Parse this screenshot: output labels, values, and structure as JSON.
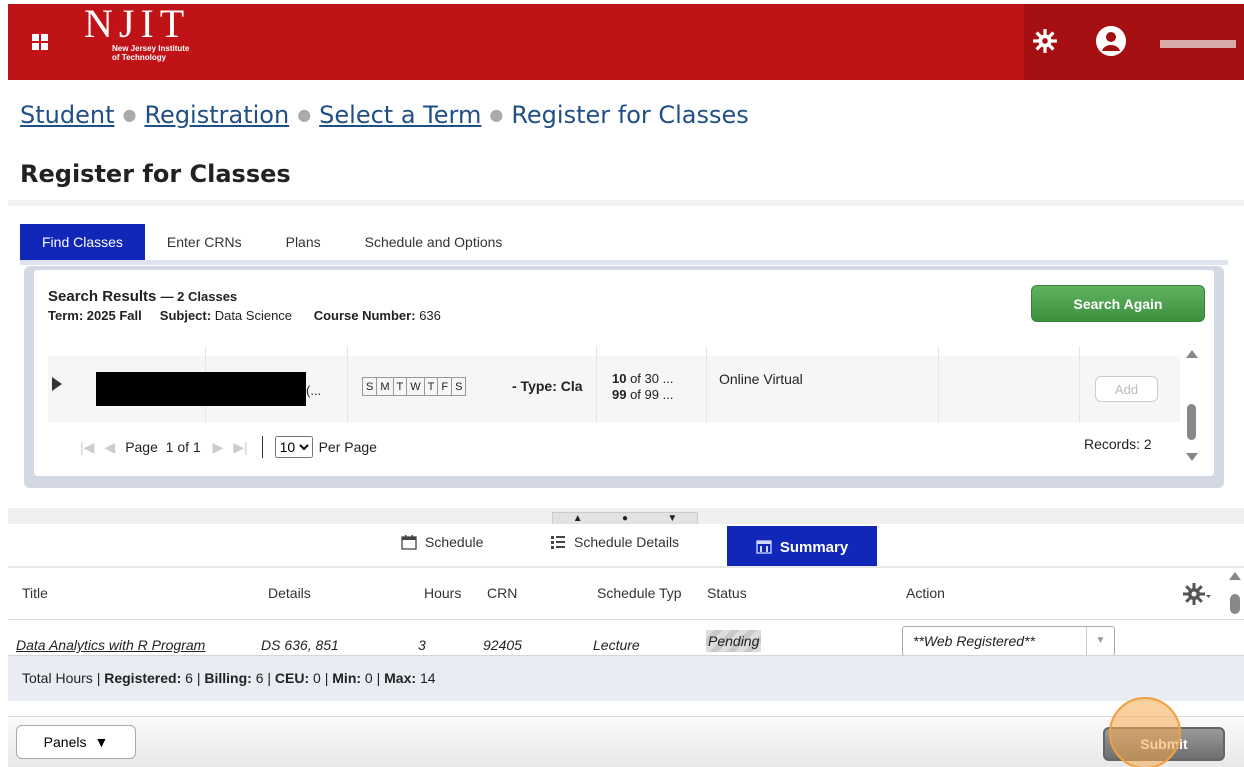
{
  "header": {
    "logo_text": "NJIT",
    "logo_sub_line1": "New Jersey Institute",
    "logo_sub_line2": "of Technology"
  },
  "breadcrumb": {
    "items": [
      "Student",
      "Registration",
      "Select a Term"
    ],
    "current": "Register for Classes"
  },
  "page_title": "Register for Classes",
  "tabs": [
    {
      "label": "Find Classes",
      "active": true
    },
    {
      "label": "Enter CRNs",
      "active": false
    },
    {
      "label": "Plans",
      "active": false
    },
    {
      "label": "Schedule and Options",
      "active": false
    }
  ],
  "search_results": {
    "title": "Search Results",
    "count_text": "— 2 Classes",
    "term_label": "Term:",
    "term_value": "2025 Fall",
    "subject_label": "Subject:",
    "subject_value": "Data Science",
    "course_label": "Course Number:",
    "course_value": "636",
    "search_again": "Search Again"
  },
  "result_row": {
    "title_trunc": "(...",
    "days": [
      "S",
      "M",
      "T",
      "W",
      "T",
      "F",
      "S"
    ],
    "type_text": "- Type: Cla",
    "seats_line1_bold": "10",
    "seats_line1_rest": " of 30 ...",
    "seats_line2_bold": "99",
    "seats_line2_rest": " of 99 ...",
    "campus": "Online Virtual",
    "add_label": "Add"
  },
  "pager": {
    "page_label": "Page",
    "page_num": "1",
    "of_text": "of",
    "page_total": "1",
    "per_page_value": "10",
    "per_page_label": "Per Page",
    "records_text": "Records: 2"
  },
  "lower_tabs": [
    {
      "label": "Schedule",
      "icon": "calendar-icon"
    },
    {
      "label": "Schedule Details",
      "icon": "list-icon"
    },
    {
      "label": "Summary",
      "icon": "summary-icon",
      "active": true
    }
  ],
  "summary_table": {
    "headers": [
      "Title",
      "Details",
      "Hours",
      "CRN",
      "Schedule Typ",
      "Status",
      "Action"
    ],
    "row": {
      "title": "Data Analytics with R Program",
      "details": "DS 636, 851",
      "hours": "3",
      "crn": "92405",
      "schedule_type": "Lecture",
      "status": "Pending",
      "action": "**Web Registered**"
    }
  },
  "totals": {
    "prefix": "Total Hours |",
    "registered_label": "Registered:",
    "registered_value": "6",
    "billing_label": "Billing:",
    "billing_value": "6",
    "ceu_label": "CEU:",
    "ceu_value": "0",
    "min_label": "Min:",
    "min_value": "0",
    "max_label": "Max:",
    "max_value": "14"
  },
  "footer": {
    "panels_label": "Panels",
    "submit_label": "Submit"
  },
  "colors": {
    "brand_red": "#c01317",
    "tab_blue": "#1027b8",
    "link_blue": "#1f4f86",
    "green": "#4ca24c"
  }
}
